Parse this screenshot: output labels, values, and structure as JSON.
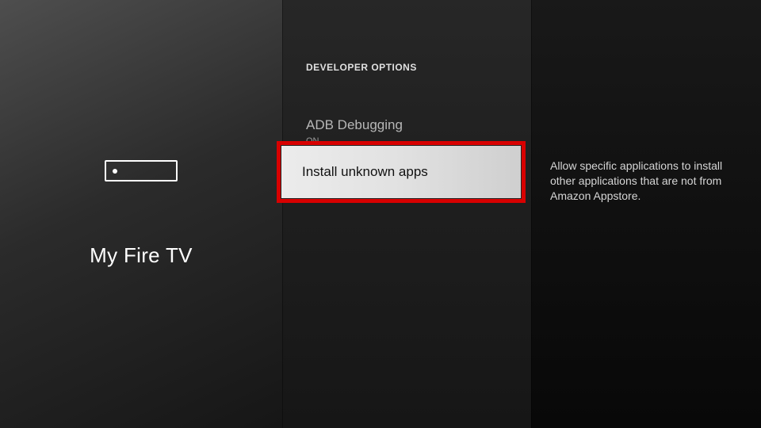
{
  "left": {
    "title": "My Fire TV"
  },
  "section": {
    "header": "DEVELOPER OPTIONS",
    "items": [
      {
        "title": "ADB Debugging",
        "sub": "ON"
      },
      {
        "title": "Install unknown apps"
      }
    ]
  },
  "description": "Allow specific applications to install other applications that are not from Amazon Appstore."
}
